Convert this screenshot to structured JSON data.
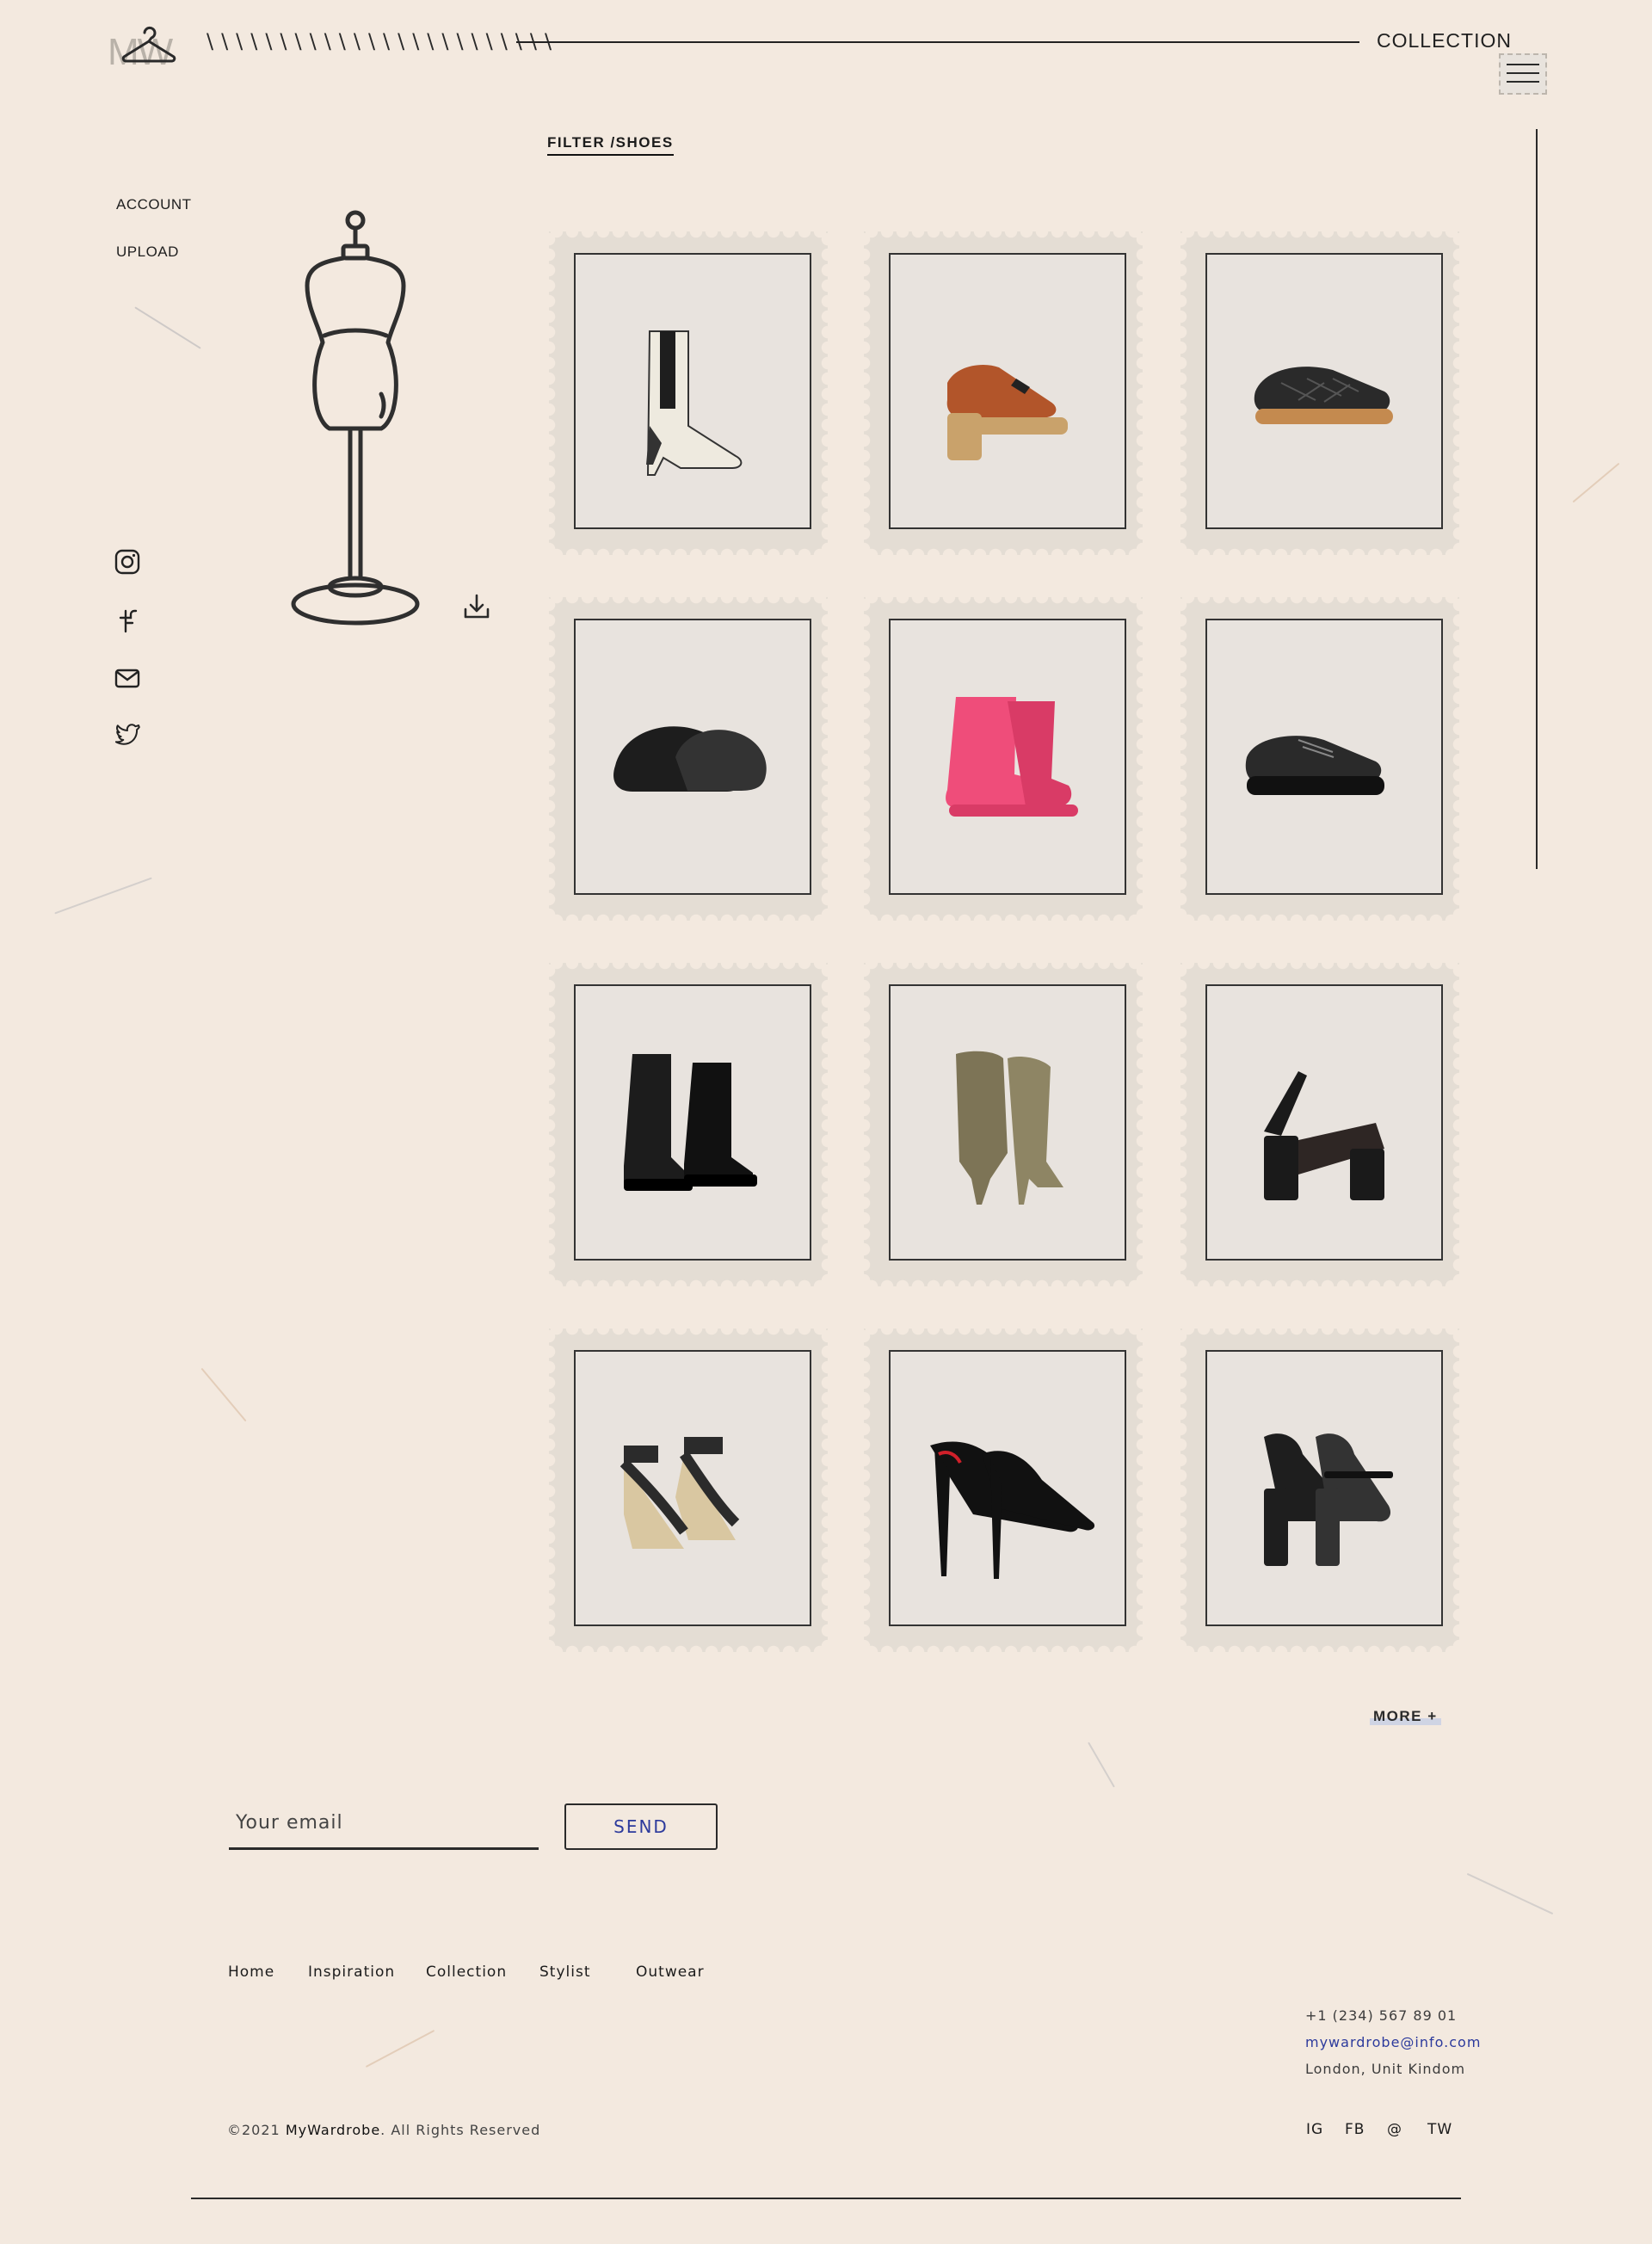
{
  "header": {
    "logo_text": "MW",
    "slashes": "\\\\\\\\\\\\\\\\\\\\\\\\\\\\\\\\\\\\\\\\\\\\\\\\",
    "section_title": "COLLECTION"
  },
  "filter": {
    "label": "FILTER /SHOES"
  },
  "sidebar": {
    "links": [
      {
        "label": "ACCOUNT"
      },
      {
        "label": "UPLOAD"
      }
    ],
    "social_icons": [
      "instagram-icon",
      "facebook-icon",
      "mail-icon",
      "twitter-icon"
    ]
  },
  "products": [
    {
      "item": "white-chelsea-boot",
      "colors": [
        "#eeeadf",
        "#1e1e1e"
      ]
    },
    {
      "item": "brown-platform-loafer",
      "colors": [
        "#b2552a",
        "#c9a26b"
      ]
    },
    {
      "item": "black-quilted-slip-on",
      "colors": [
        "#2a2a2a",
        "#c48a4f"
      ]
    },
    {
      "item": "black-leather-clog",
      "colors": [
        "#1d1d1d",
        "#333333"
      ]
    },
    {
      "item": "pink-rubber-boot",
      "colors": [
        "#ef4d7a",
        "#d93b66"
      ]
    },
    {
      "item": "black-derby-shoe",
      "colors": [
        "#2a2a2a",
        "#111111"
      ]
    },
    {
      "item": "black-combat-boot",
      "colors": [
        "#1c1c1c",
        "#111111"
      ]
    },
    {
      "item": "olive-suede-cowboy-boot",
      "colors": [
        "#7d7456",
        "#8e8564"
      ]
    },
    {
      "item": "black-platform-sandal",
      "colors": [
        "#1a1a1a",
        "#2e2624"
      ]
    },
    {
      "item": "studded-espadrille-wedge",
      "colors": [
        "#2b2b2b",
        "#d9c7a1"
      ]
    },
    {
      "item": "black-patent-pump",
      "colors": [
        "#111111",
        "#d0202a"
      ]
    },
    {
      "item": "black-mary-jane-heel",
      "colors": [
        "#1e1e1e",
        "#333333"
      ]
    }
  ],
  "more": {
    "label": "MORE +"
  },
  "newsletter": {
    "placeholder": "Your email",
    "send_label": "SEND"
  },
  "footer": {
    "links": [
      "Home",
      "Inspiration",
      "Collection",
      "Stylist",
      "Outwear"
    ],
    "phone": "+1 (234) 567 89 01",
    "email": "mywardrobe@info.com",
    "location": "London, Unit Kindom",
    "copyright_prefix": "©2021 ",
    "copyright_brand": "MyWardrobe",
    "copyright_suffix": ". All Rights Reserved",
    "social": [
      "IG",
      "FB",
      "@",
      "TW"
    ]
  },
  "colors": {
    "background": "#f3e9df",
    "stamp": "#e4ddd4",
    "accent_blue": "#2c3a9c",
    "ink": "#1b1b1b"
  }
}
